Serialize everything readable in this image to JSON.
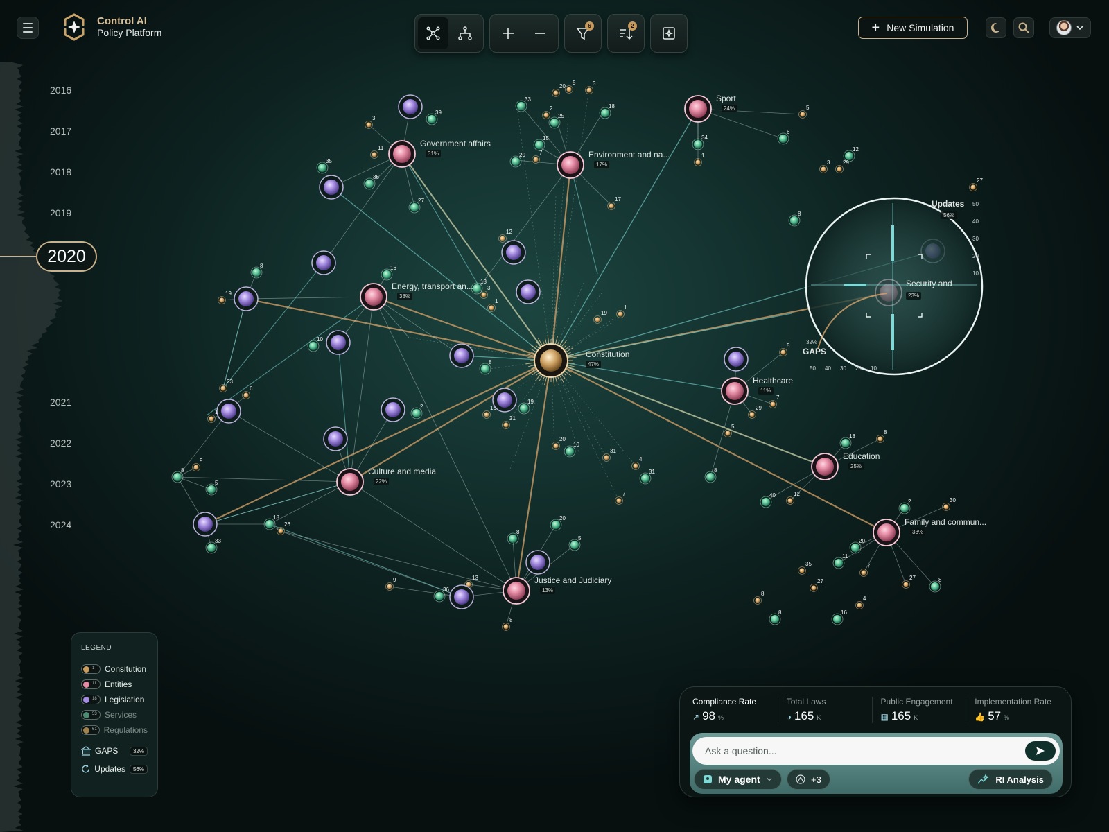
{
  "app": {
    "title": "Control AI",
    "subtitle": "Policy Platform"
  },
  "toolbar": {
    "filter_badge": "6",
    "sort_badge": "2"
  },
  "header": {
    "new_simulation_label": "New Simulation"
  },
  "timeline": {
    "years_top": [
      "2016",
      "2017",
      "2018",
      "2019"
    ],
    "selected_year": "2020",
    "years_bottom": [
      "2021",
      "2022",
      "2023",
      "2024"
    ]
  },
  "hubs": [
    {
      "name": "Constitution",
      "pct": "47%"
    },
    {
      "name": "Government affairs",
      "pct": "31%"
    },
    {
      "name": "Environment and na...",
      "pct": "17%"
    },
    {
      "name": "Sport",
      "pct": "24%"
    },
    {
      "name": "Energy, transport an...",
      "pct": "38%"
    },
    {
      "name": "Healthcare",
      "pct": "11%"
    },
    {
      "name": "Education",
      "pct": "25%"
    },
    {
      "name": "Culture and media",
      "pct": "22%"
    },
    {
      "name": "Family and commun...",
      "pct": "33%"
    },
    {
      "name": "Justice and Judiciary",
      "pct": "13%"
    },
    {
      "name": "Security and",
      "pct": "23%"
    }
  ],
  "node_counts": [
    "3",
    "11",
    "39",
    "35",
    "36",
    "27",
    "33",
    "20",
    "2",
    "25",
    "15",
    "20",
    "7",
    "5",
    "3",
    "18",
    "17",
    "5",
    "6",
    "34",
    "1",
    "12",
    "3",
    "29",
    "8",
    "19",
    "16",
    "10",
    "13",
    "1",
    "12",
    "8",
    "19",
    "16",
    "21",
    "23",
    "6",
    "13",
    "2",
    "9",
    "8",
    "5",
    "33",
    "18",
    "26",
    "20",
    "10",
    "31",
    "4",
    "31",
    "7",
    "20",
    "8",
    "5",
    "9",
    "36",
    "13",
    "8",
    "5",
    "29",
    "7",
    "5",
    "8",
    "18",
    "8",
    "40",
    "12",
    "2",
    "30",
    "20",
    "11",
    "7",
    "35",
    "27",
    "8",
    "8",
    "16",
    "4",
    "27",
    "8",
    "8",
    "27",
    "3",
    "19",
    "1"
  ],
  "magnifier": {
    "title": "Updates",
    "updates_pct": "56%",
    "gaps_label": "GAPS",
    "gaps_pct": "32%",
    "scale_right": [
      "50",
      "40",
      "30",
      "20",
      "10"
    ],
    "scale_bottom": [
      "50",
      "40",
      "30",
      "20",
      "10"
    ]
  },
  "legend": {
    "title": "LEGEND",
    "items": [
      {
        "label": "Consitution",
        "count": "1",
        "color": "#c99c5d",
        "dim": false
      },
      {
        "label": "Entities",
        "count": "11",
        "color": "#e48ba4",
        "dim": false
      },
      {
        "label": "Legislation",
        "count": "18",
        "color": "#a48ce0",
        "dim": false
      },
      {
        "label": "Services",
        "count": "53",
        "color": "#4d8a74",
        "dim": true
      },
      {
        "label": "Regulations",
        "count": "61",
        "color": "#a1814e",
        "dim": true
      }
    ],
    "gaps_label": "GAPS",
    "gaps_pct": "32%",
    "updates_label": "Updates",
    "updates_pct": "56%"
  },
  "metrics": [
    {
      "label": "Compliance Rate",
      "value": "98",
      "unit": "%"
    },
    {
      "label": "Total Laws",
      "value": "165",
      "unit": "K"
    },
    {
      "label": "Public Engagement",
      "value": "165",
      "unit": "K"
    },
    {
      "label": "Implementation Rate",
      "value": "57",
      "unit": "%"
    }
  ],
  "ask": {
    "placeholder": "Ask a question...",
    "agent_label": "My agent",
    "extra_label": "+3",
    "ri_label": "RI Analysis"
  },
  "colors": {
    "accent_gold": "#c9b28c",
    "entity_pink": "#e48ba4",
    "legislation_purple": "#a48ce0",
    "service_green": "#5fc89a",
    "regulation_orange": "#d9a462",
    "link_cyan": "#7fd9d6"
  }
}
